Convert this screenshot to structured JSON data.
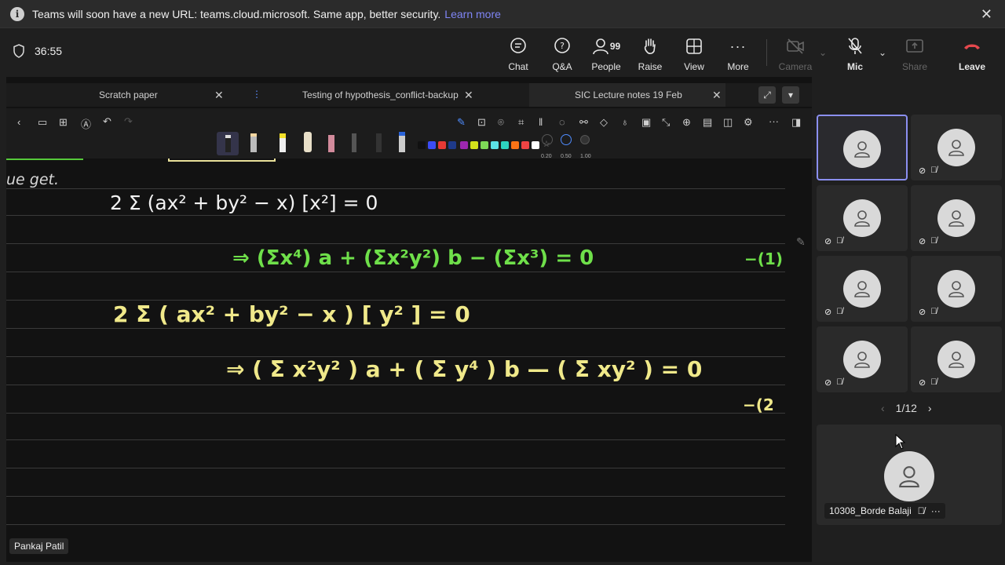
{
  "banner": {
    "message": "Teams will soon have a new URL: teams.cloud.microsoft. Same app, better security.",
    "link": "Learn more"
  },
  "meeting": {
    "timer": "36:55"
  },
  "toolbar": {
    "chat": "Chat",
    "qa": "Q&A",
    "people": "People",
    "people_count": "99",
    "raise": "Raise",
    "view": "View",
    "more": "More",
    "camera": "Camera",
    "mic": "Mic",
    "share": "Share",
    "leave": "Leave"
  },
  "notebook": {
    "tabs": [
      "Scratch paper",
      "Testing of hypothesis_conflict-backup",
      "SIC Lecture notes 19 Feb"
    ],
    "pen_thickness": [
      "0.20",
      "0.50",
      "1.00"
    ],
    "colors": [
      "#111111",
      "#3b4cf5",
      "#e53935",
      "#1e3a8a",
      "#9c27b0",
      "#d4e21b",
      "#7ed957",
      "#5ce1e6",
      "#2dd4bf",
      "#f97316",
      "#ef4444",
      "#ffffff"
    ]
  },
  "note": {
    "line0": "ue   get.",
    "line1": "2 Σ (ax² + by² − x) [x²] = 0",
    "line2": "⇒ (Σx⁴) a + (Σx²y²) b − (Σx³) = 0",
    "tag1": "−(1)",
    "line3": "2 Σ ( ax² + by² − x ) [ y² ]  = 0",
    "line4": "⇒ ( Σ x²y² ) a  +  ( Σ y⁴ ) b — ( Σ xy² ) = 0",
    "tag2": "−(2"
  },
  "presenter": "Pankaj Patil",
  "participants": {
    "page": "1/12",
    "featured_name": "10308_Borde Balaji"
  }
}
